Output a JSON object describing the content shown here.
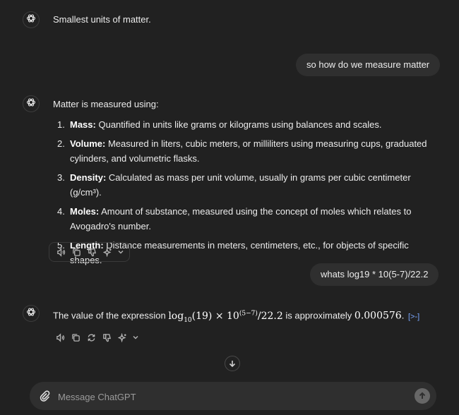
{
  "messages": {
    "m1_text": "Smallest units of matter.",
    "u1_text": "so how do we measure matter",
    "m2_intro": "Matter is measured using:",
    "m2_items": [
      {
        "num": "1.",
        "term": "Mass:",
        "desc": " Quantified in units like grams or kilograms using balances and scales."
      },
      {
        "num": "2.",
        "term": "Volume:",
        "desc": " Measured in liters, cubic meters, or milliliters using measuring cups, graduated cylinders, and volumetric flasks."
      },
      {
        "num": "3.",
        "term": "Density:",
        "desc": " Calculated as mass per unit volume, usually in grams per cubic centimeter (g/cm³)."
      },
      {
        "num": "4.",
        "term": "Moles:",
        "desc": " Amount of substance, measured using the concept of moles which relates to Avogadro's number."
      },
      {
        "num": "5.",
        "term": "Length:",
        "desc": " Distance measurements in meters, centimeters, etc., for objects of specific shapes."
      }
    ],
    "u2_text": "whats log19 * 10(5-7)/22.2",
    "m3_prefix": "The value of the expression ",
    "m3_math_log": "log",
    "m3_math_base": "10",
    "m3_math_arg": "(19) × 10",
    "m3_math_exp": "(5−7)",
    "m3_math_div": "/22.2",
    "m3_mid": " is approximately ",
    "m3_value": "0.000576",
    "m3_end": ".",
    "m3_cite": "[>-]"
  },
  "composer": {
    "placeholder": "Message ChatGPT"
  },
  "icons": {
    "assistant_avatar": "openai-logo-icon",
    "read_aloud": "speaker-icon",
    "copy": "copy-icon",
    "regenerate": "regenerate-icon",
    "thumbs_down": "thumbs-down-icon",
    "model_switch": "sparkle-icon",
    "scroll_down": "arrow-down-icon",
    "attach": "paperclip-icon",
    "send": "arrow-up-icon"
  }
}
